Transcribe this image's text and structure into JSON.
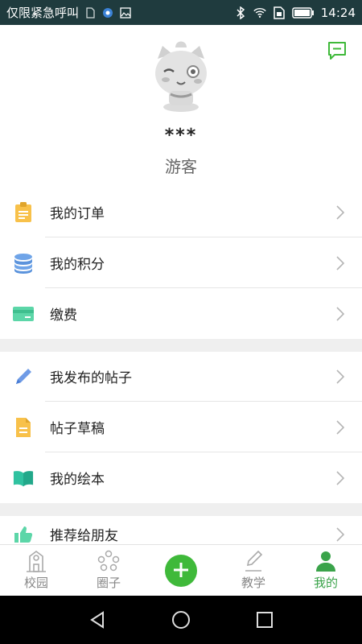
{
  "status_bar": {
    "carrier": "仅限紧急呼叫",
    "time": "14:24"
  },
  "profile": {
    "name": "***",
    "role": "游客"
  },
  "menu_group_1": [
    {
      "label": "我的订单",
      "icon": "clipboard-icon"
    },
    {
      "label": "我的积分",
      "icon": "coins-icon"
    },
    {
      "label": "缴费",
      "icon": "card-icon"
    }
  ],
  "menu_group_2": [
    {
      "label": "我发布的帖子",
      "icon": "pen-icon"
    },
    {
      "label": "帖子草稿",
      "icon": "document-icon"
    },
    {
      "label": "我的绘本",
      "icon": "book-icon"
    }
  ],
  "menu_group_3": [
    {
      "label": "推荐给朋友",
      "icon": "thumbs-up-icon"
    }
  ],
  "tabs": [
    {
      "label": "校园",
      "icon": "school-icon"
    },
    {
      "label": "圈子",
      "icon": "circle-icon"
    },
    {
      "label": "",
      "icon": "plus-icon"
    },
    {
      "label": "教学",
      "icon": "teach-icon"
    },
    {
      "label": "我的",
      "icon": "user-icon"
    }
  ],
  "colors": {
    "accent": "#3aa34a",
    "status_bar": "#1f3b3e"
  }
}
